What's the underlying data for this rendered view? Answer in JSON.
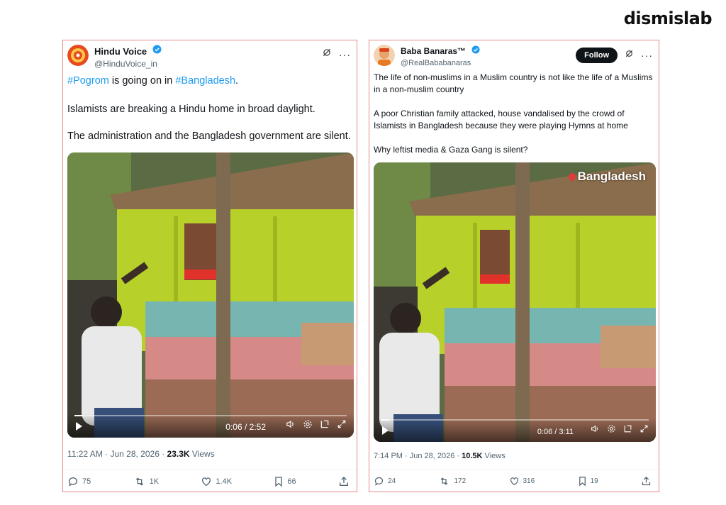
{
  "brand": "dismislab",
  "tweets": [
    {
      "name": "Hindu Voice",
      "handle": "@HinduVoice_in",
      "text_parts": [
        "#Pogrom",
        " is going on in ",
        "#Bangladesh",
        "."
      ],
      "paragraphs": [
        "Islamists are breaking a Hindu home in broad daylight.",
        "The administration and the Bangladesh government are silent."
      ],
      "video": {
        "time": "0:06 / 2:52",
        "progress": 0.035
      },
      "meta": {
        "datetime": "11:22 AM · Jun 28, 2026 · ",
        "views_count": "23.3K",
        "views_label": " Views"
      },
      "actions": {
        "replies": "75",
        "reposts": "1K",
        "likes": "1.4K",
        "bookmarks": "66"
      }
    },
    {
      "name": "Baba Banaras™",
      "handle": "@RealBababanaras",
      "follow_label": "Follow",
      "paragraphs": [
        "The life of non-muslims in a Muslim country is not like the life of a Muslims in a non-muslim country",
        "A poor Christian family attacked, house vandalised by the crowd of Islamists in Bangladesh because they were playing Hymns at home",
        "Why leftist media & Gaza Gang is silent?"
      ],
      "video": {
        "time": "0:06 / 3:11",
        "overlay": "Bangladesh",
        "progress": 0.031
      },
      "meta": {
        "datetime": "7:14 PM · Jun 28, 2026 · ",
        "views_count": "10.5K",
        "views_label": " Views"
      },
      "actions": {
        "replies": "24",
        "reposts": "172",
        "likes": "316",
        "bookmarks": "19"
      }
    }
  ],
  "colors": {
    "link": "#1d9bf0",
    "verified": "#1d9bf0",
    "card_border": "#e48a8a",
    "wall": "#b7d12a"
  },
  "icons": [
    "grok-icon",
    "more-icon",
    "verified-icon",
    "reply-icon",
    "repost-icon",
    "like-icon",
    "bookmark-icon",
    "share-icon",
    "play-icon",
    "volume-icon",
    "settings-icon",
    "pip-icon",
    "fullscreen-icon",
    "location-pin-icon"
  ]
}
